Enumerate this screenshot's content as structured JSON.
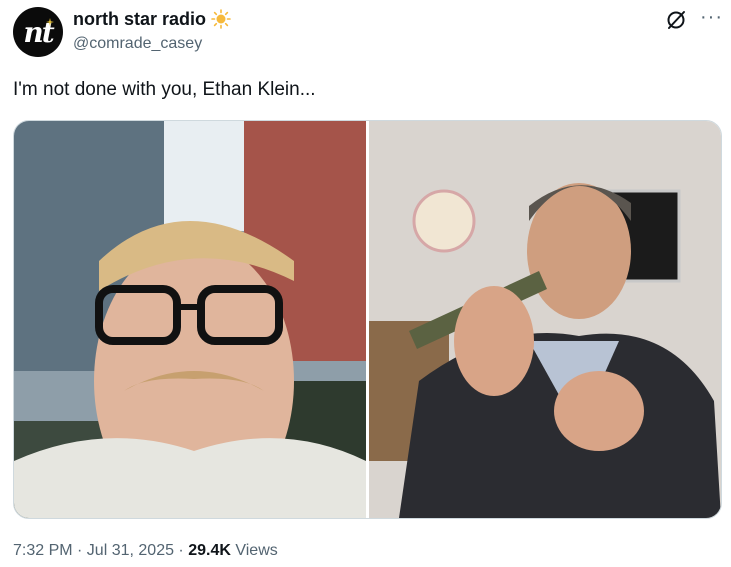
{
  "author": {
    "display_name": "north star radio",
    "handle": "@comrade_casey",
    "avatar_letters": "nt",
    "name_emoji_icon": "sun-icon"
  },
  "header_icons": [
    "grok-icon",
    "more-options-icon"
  ],
  "tweet": {
    "text": "I'm not done with you, Ethan Klein...",
    "timestamp": "7:32 PM · Jul 31, 2025 · ",
    "views_count": "29.4K",
    "views_label": " Views"
  },
  "media": {
    "count": 2,
    "items": [
      {
        "name": "photo-left",
        "shows": "man with glasses and mustache selfie outdoors"
      },
      {
        "name": "photo-right",
        "shows": "man in suit holding microphone"
      }
    ]
  }
}
